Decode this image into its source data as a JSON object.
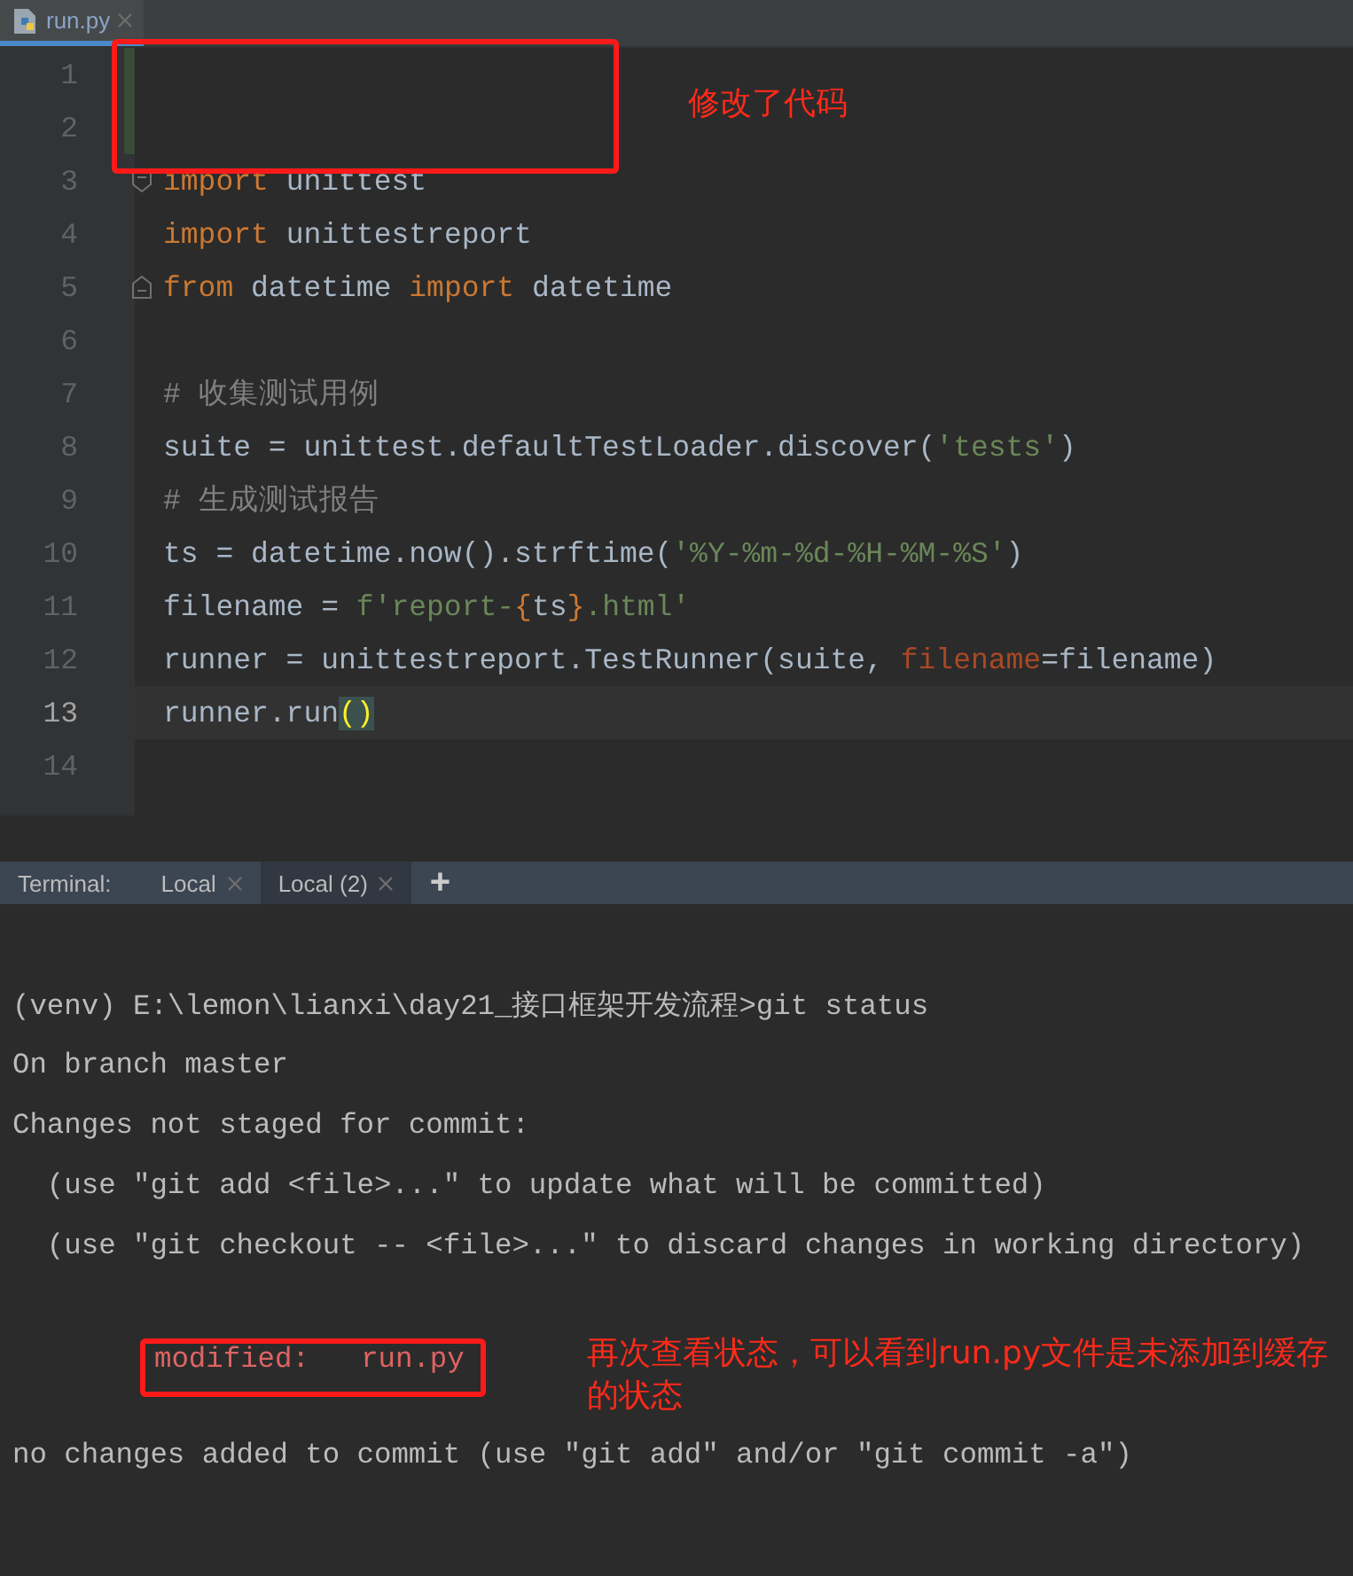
{
  "editor_tab": {
    "label": "run.py",
    "selected": true
  },
  "code_lines": [
    {
      "number": "1",
      "kind": "plain",
      "changed": true,
      "current": false
    },
    {
      "number": "2",
      "kind": "plain",
      "changed": true,
      "current": false
    },
    {
      "number": "3",
      "kind": "fold_start",
      "changed": false,
      "current": false,
      "tokens": [
        {
          "text": "import",
          "kind": "keyword"
        },
        {
          "text": " unittest",
          "kind": "plain"
        }
      ]
    },
    {
      "number": "4",
      "kind": "plain",
      "changed": false,
      "current": false,
      "tokens": [
        {
          "text": "import",
          "kind": "keyword"
        },
        {
          "text": " unittestreport",
          "kind": "plain"
        }
      ]
    },
    {
      "number": "5",
      "kind": "fold_end",
      "changed": false,
      "current": false,
      "tokens": [
        {
          "text": "from",
          "kind": "keyword"
        },
        {
          "text": " datetime ",
          "kind": "plain"
        },
        {
          "text": "import",
          "kind": "keyword"
        },
        {
          "text": " datetime",
          "kind": "plain"
        }
      ]
    },
    {
      "number": "6",
      "kind": "plain",
      "changed": false,
      "current": false
    },
    {
      "number": "7",
      "kind": "plain",
      "changed": false,
      "current": false,
      "tokens": [
        {
          "text": "# 收集测试用例",
          "kind": "comment"
        }
      ]
    },
    {
      "number": "8",
      "kind": "plain",
      "changed": false,
      "current": false,
      "tokens": [
        {
          "text": "suite = unittest.defaultTestLoader.discover(",
          "kind": "plain"
        },
        {
          "text": "'tests'",
          "kind": "string"
        },
        {
          "text": ")",
          "kind": "plain"
        }
      ]
    },
    {
      "number": "9",
      "kind": "plain",
      "changed": false,
      "current": false,
      "tokens": [
        {
          "text": "# 生成测试报告",
          "kind": "comment"
        }
      ]
    },
    {
      "number": "10",
      "kind": "plain",
      "changed": false,
      "current": false,
      "tokens": [
        {
          "text": "ts = datetime.now().strftime(",
          "kind": "plain"
        },
        {
          "text": "'%Y-%m-%d-%H-%M-%S'",
          "kind": "string"
        },
        {
          "text": ")",
          "kind": "plain"
        }
      ]
    },
    {
      "number": "11",
      "kind": "plain",
      "changed": false,
      "current": false,
      "tokens": [
        {
          "text": "filename = ",
          "kind": "plain"
        },
        {
          "text": "f'report-",
          "kind": "string"
        },
        {
          "text": "{",
          "kind": "brace"
        },
        {
          "text": "ts",
          "kind": "plain"
        },
        {
          "text": "}",
          "kind": "brace"
        },
        {
          "text": ".html'",
          "kind": "string"
        }
      ]
    },
    {
      "number": "12",
      "kind": "plain",
      "changed": false,
      "current": false,
      "tokens": [
        {
          "text": "runner = unittestreport.TestRunner(suite, ",
          "kind": "plain"
        },
        {
          "text": "filename",
          "kind": "param"
        },
        {
          "text": "=filename)",
          "kind": "plain"
        }
      ]
    },
    {
      "number": "13",
      "kind": "plain",
      "changed": false,
      "current": true,
      "tokens": [
        {
          "text": "runner.run",
          "kind": "plain"
        },
        {
          "text": "()",
          "kind": "match"
        }
      ]
    },
    {
      "number": "14",
      "kind": "plain",
      "changed": false,
      "current": false
    }
  ],
  "terminal": {
    "label": "Terminal:",
    "tabs": [
      {
        "label": "Local",
        "selected": false
      },
      {
        "label": "Local (2)",
        "selected": true
      }
    ],
    "new_tab": "+",
    "lines": [
      {
        "kind": "output",
        "text": "(venv) E:\\lemon\\lianxi\\day21_接口框架开发流程>git status"
      },
      {
        "kind": "output",
        "text": "On branch master"
      },
      {
        "kind": "output",
        "text": "Changes not staged for commit:"
      },
      {
        "kind": "output",
        "text": "  (use \"git add <file>...\" to update what will be committed)"
      },
      {
        "kind": "output",
        "text": "  (use \"git checkout -- <file>...\" to discard changes in working directory)"
      },
      {
        "kind": "modified",
        "text": "modified:   run.py"
      },
      {
        "kind": "output",
        "text": "no changes added to commit (use \"git add\" and/or \"git commit -a\")"
      }
    ]
  },
  "annotations": [
    {
      "text": "修改了代码"
    },
    {
      "text": "再次查看状态，可以看到run.py文件是未添加到缓存的状态"
    }
  ]
}
